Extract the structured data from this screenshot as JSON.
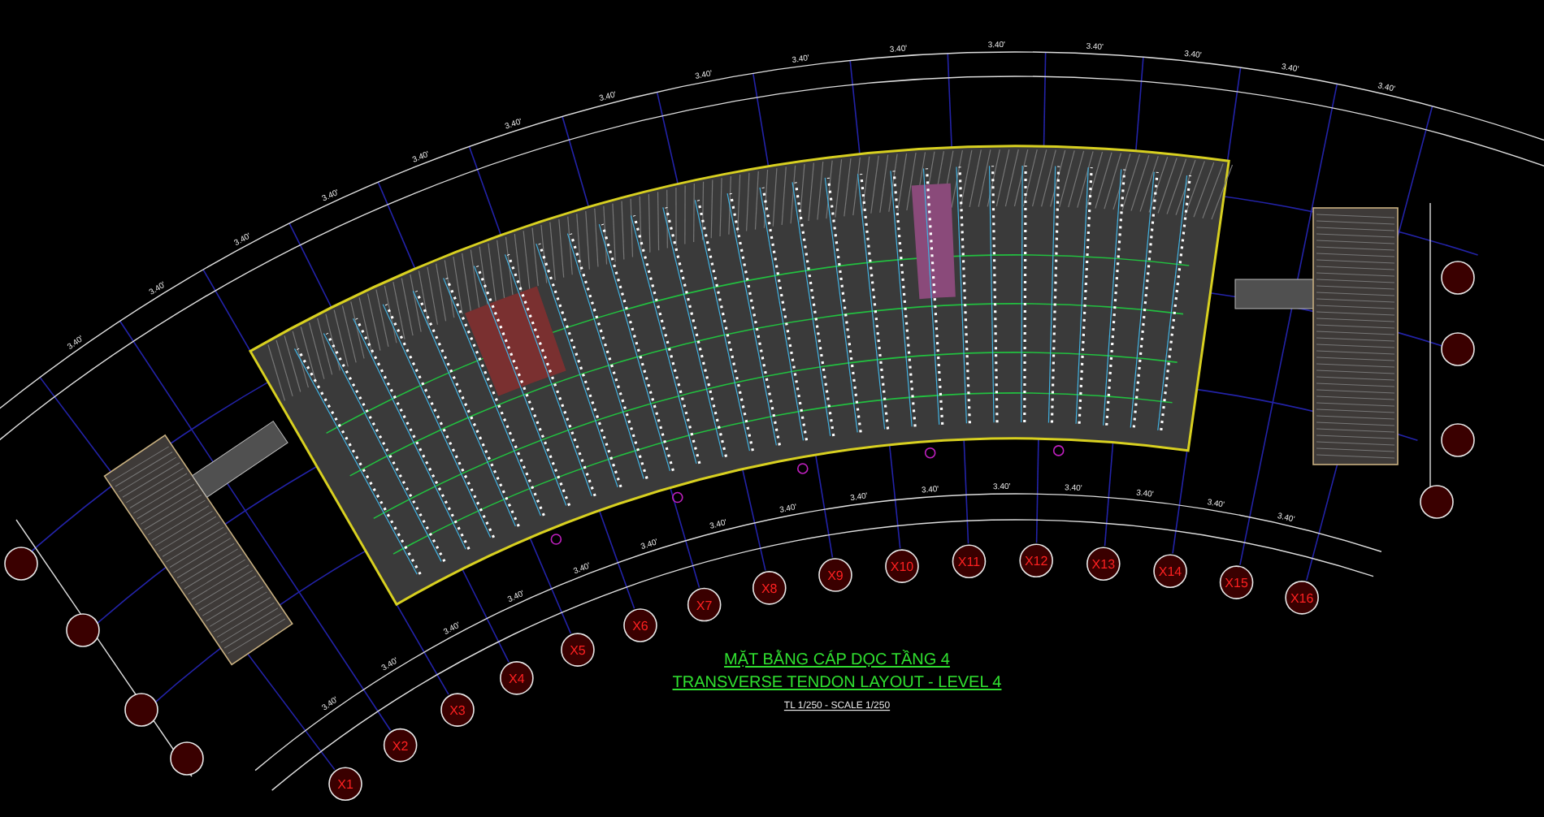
{
  "drawing": {
    "title": "MẶT BẰNG CÁP DỌC TẦNG 4",
    "subtitle": "TRANSVERSE TENDON LAYOUT - LEVEL 4",
    "scale": "TL 1/250 - SCALE 1/250"
  },
  "grid_bubbles": [
    "X1",
    "X2",
    "X3",
    "X4",
    "X5",
    "X6",
    "X7",
    "X8",
    "X9",
    "X10",
    "X11",
    "X12",
    "X13",
    "X14",
    "X15",
    "X16"
  ],
  "bottom_dimensions": [
    "3.40'",
    "3.40'",
    "3.40'",
    "3.40'",
    "3.40'",
    "3.40'",
    "3.40'",
    "3.40'",
    "3.40'",
    "3.40'",
    "3.40'",
    "3.40'",
    "3.40'",
    "3.40'",
    "3.40'"
  ],
  "top_dimensions": [
    "3.40'",
    "3.40'",
    "3.40'",
    "3.40'",
    "3.40'",
    "3.40'",
    "3.40'",
    "3.40'",
    "3.40'",
    "3.40'",
    "3.40'",
    "3.40'",
    "3.40'",
    "3.40'",
    "3.40'"
  ]
}
